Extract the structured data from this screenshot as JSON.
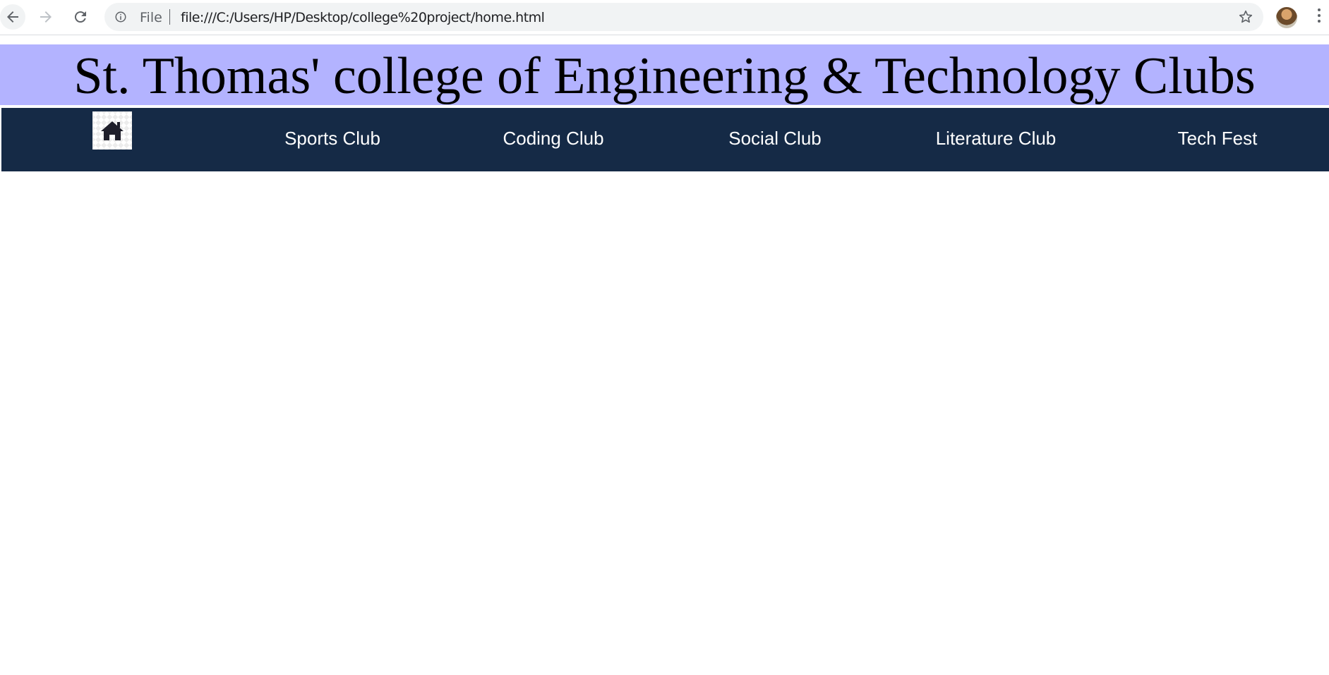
{
  "browser": {
    "back_icon": "arrow-left-icon",
    "forward_icon": "arrow-right-icon",
    "reload_icon": "reload-icon",
    "info_icon": "info-icon",
    "scheme_label": "File",
    "url": "file:///C:/Users/HP/Desktop/college%20project/home.html",
    "bookmark_icon": "star-icon",
    "menu_icon": "kebab-menu-icon"
  },
  "page": {
    "title": "St. Thomas' college of Engineering & Technology Clubs",
    "colors": {
      "banner_bg": "#b3b3ff",
      "nav_bg": "#152a46",
      "nav_text": "#ffffff"
    },
    "nav": {
      "home_icon": "home-icon",
      "items": [
        {
          "label": "Sports Club"
        },
        {
          "label": "Coding Club"
        },
        {
          "label": "Social Club"
        },
        {
          "label": "Literature Club"
        },
        {
          "label": "Tech Fest"
        }
      ]
    }
  }
}
